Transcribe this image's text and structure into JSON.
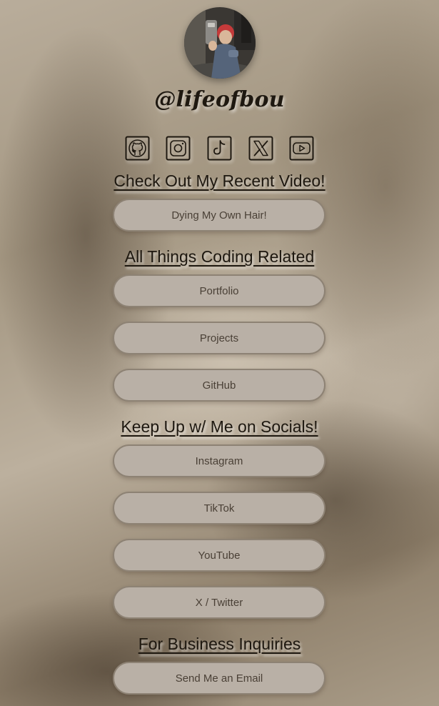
{
  "profile": {
    "username": "@lifeofbou",
    "avatar": "profile-photo"
  },
  "socials": [
    {
      "icon": "github-icon"
    },
    {
      "icon": "instagram-icon"
    },
    {
      "icon": "tiktok-icon"
    },
    {
      "icon": "x-twitter-icon"
    },
    {
      "icon": "youtube-icon"
    }
  ],
  "sections": {
    "recent_video": {
      "heading": "Check Out My Recent Video!",
      "links": [
        "Dying My Own Hair!"
      ]
    },
    "coding": {
      "heading": "All Things Coding Related",
      "links": [
        "Portfolio",
        "Projects",
        "GitHub"
      ]
    },
    "socials": {
      "heading": "Keep Up w/ Me on Socials!",
      "links": [
        "Instagram",
        "TikTok",
        "YouTube",
        "X / Twitter"
      ]
    },
    "business": {
      "heading": "For Business Inquiries",
      "links": [
        "Send Me an Email"
      ]
    }
  },
  "colors": {
    "text": "#1e1810",
    "button_bg": "#b9b0a6",
    "button_border": "#8d8274",
    "button_text": "#4a4036"
  }
}
